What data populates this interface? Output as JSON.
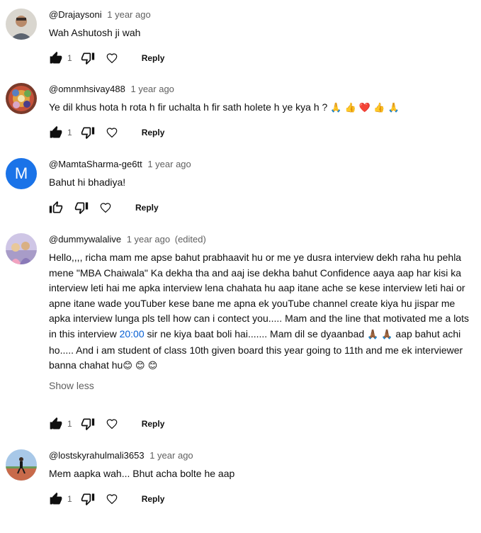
{
  "comments": [
    {
      "author": "@Drajaysoni",
      "time": "1 year ago",
      "edited": "",
      "text": "Wah Ashutosh ji wah",
      "likes": "1",
      "liked": true,
      "reply_label": "Reply",
      "avatar_icon": "profile-photo"
    },
    {
      "author": "@omnmhsivay488",
      "time": "1 year ago",
      "edited": "",
      "text": "Ye dil khus hota h rota h fir uchalta h fir sath holete h ye kya h ?",
      "emojis": "🙏 👍 ❤️ 👍 🙏",
      "likes": "1",
      "liked": true,
      "reply_label": "Reply",
      "avatar_icon": "profile-photo"
    },
    {
      "author": "@MamtaSharma-ge6tt",
      "time": "1 year ago",
      "edited": "",
      "text": "Bahut hi bhadiya!",
      "likes": "",
      "liked": false,
      "reply_label": "Reply",
      "avatar_letter": "M",
      "avatar_color": "#1a73e8"
    },
    {
      "author": "@dummywalalive",
      "time": "1 year ago",
      "edited": "(edited)",
      "text_part1": "Hello,,,, richa mam me apse bahut prabhaavit hu or me ye dusra interview dekh raha hu pehla mene \"MBA Chaiwala\" Ka dekha tha and aaj ise dekha bahut Confidence aaya aap har kisi ka interview leti hai me apka interview lena chahata hu aap itane ache se kese interview leti hai or apne itane wade youTuber kese bane me apna ek youTube channel create kiya hu jispar me apka interview lunga pls tell how can i contect you..... Mam and the line that  motivated me  a lots in this interview ",
      "timestamp_link": "20:00",
      "text_part2": " sir ne kiya baat boli hai....... Mam dil se dyaanbad ",
      "emoji_a": "🙏🏾 🙏🏾",
      "text_part3": " aap bahut achi ho..... And i am student of class 10th given board this year going to 11th and me ek interviewer banna chahat hu",
      "emoji_b": "😊 😊 😊",
      "show_less": "Show less",
      "likes": "1",
      "liked": true,
      "reply_label": "Reply",
      "avatar_icon": "profile-photo"
    },
    {
      "author": "@lostskyrahulmali3653",
      "time": "1 year ago",
      "edited": "",
      "text": "Mem aapka wah... Bhut acha bolte he aap",
      "likes": "1",
      "liked": true,
      "reply_label": "Reply",
      "avatar_icon": "profile-photo"
    }
  ],
  "colors": {
    "text": "#0f0f0f",
    "secondary": "#606060",
    "link": "#065fd4"
  }
}
